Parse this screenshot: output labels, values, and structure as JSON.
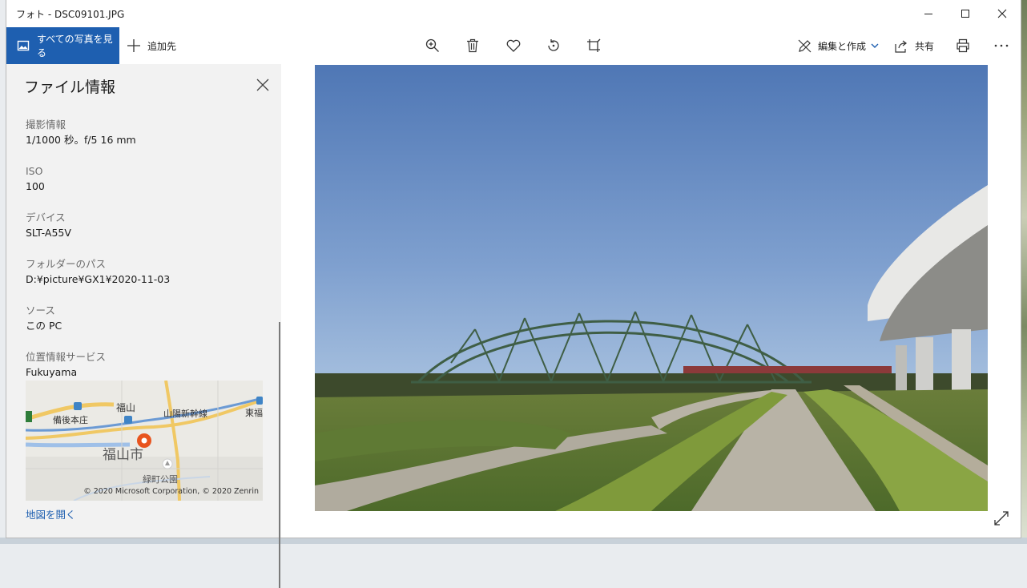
{
  "window": {
    "title": "フォト - DSC09101.JPG"
  },
  "toolbar": {
    "all_photos_label": "すべての写真を見る",
    "add_to_label": "追加先",
    "edit_create_label": "編集と作成",
    "share_label": "共有"
  },
  "panel": {
    "title": "ファイル情報",
    "fields": [
      {
        "label": "撮影情報",
        "value": "1/1000 秒。f/5 16 mm"
      },
      {
        "label": "ISO",
        "value": "100"
      },
      {
        "label": "デバイス",
        "value": "SLT-A55V"
      },
      {
        "label": "フォルダーのパス",
        "value": "D:¥picture¥GX1¥2020-11-03"
      },
      {
        "label": "ソース",
        "value": "この PC"
      },
      {
        "label": "位置情報サービス",
        "value": "Fukuyama"
      }
    ],
    "map": {
      "labels": [
        "福山",
        "山陽新幹線",
        "備後本庄",
        "東福",
        "福山市",
        "緑町公園"
      ],
      "copyright": "© 2020 Microsoft Corporation, © 2020 Zenrin"
    },
    "open_map_label": "地図を開く"
  },
  "icons": [
    "photo-icon",
    "plus-icon",
    "zoom-in-icon",
    "delete-icon",
    "heart-icon",
    "rotate-icon",
    "crop-icon",
    "edit-icon",
    "chevron-down-icon",
    "share-icon",
    "print-icon",
    "more-icon",
    "close-icon",
    "expand-icon",
    "map-pin-icon"
  ],
  "colors": {
    "accent": "#1e5fb0",
    "panel_bg": "#f2f2f2",
    "map_pin": "#e8541e"
  }
}
